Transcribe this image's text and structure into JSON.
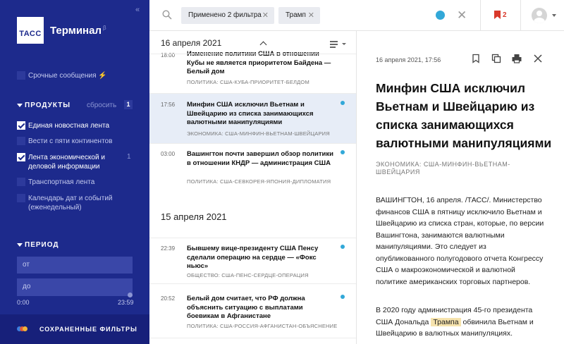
{
  "sidebar": {
    "logo": "ТАСС",
    "title": "Терминал",
    "title_sup": "β",
    "urgent": "Срочные сообщения ⚡",
    "products_header": "ПРОДУКТЫ",
    "reset": "сбросить",
    "selected_count": "1",
    "products": [
      {
        "label": "Единая новостная лента",
        "checked": true,
        "count": ""
      },
      {
        "label": "Вести с пяти континентов",
        "checked": false,
        "count": ""
      },
      {
        "label": "Лента экономической и деловой информации",
        "checked": true,
        "count": "1"
      },
      {
        "label": "Транспортная лента",
        "checked": false,
        "count": ""
      },
      {
        "label": "Календарь дат и событий (еженедельный)",
        "checked": false,
        "count": ""
      }
    ],
    "period_header": "ПЕРИОД",
    "from_placeholder": "от",
    "to_placeholder": "до",
    "range_start": "0:00",
    "range_end": "23:59",
    "saved_filters": "СОХРАНЕННЫЕ ФИЛЬТРЫ"
  },
  "topbar": {
    "filters_chip": "Применено 2 фильтра",
    "query_chip": "Трамп",
    "bookmarks_count": "2"
  },
  "feed": {
    "date_1": "16 апреля 2021",
    "date_2": "15 апреля 2021",
    "items": [
      {
        "time": "18:00",
        "title": "Изменение политики США в отношении Кубы не является приоритетом Байдена — Белый дом",
        "rubric": "ПОЛИТИКА: США-КУБА-ПРИОРИТЕТ-БЕЛДОМ",
        "selected": false,
        "dot": false
      },
      {
        "time": "17:56",
        "title": "Минфин США исключил Вьетнам и Швейцарию из списка занимающихся валютными манипуляциями",
        "rubric": "ЭКОНОМИКА: США-МИНФИН-ВЬЕТНАМ-ШВЕЙЦАРИЯ",
        "selected": true,
        "dot": true
      },
      {
        "time": "03:00",
        "title": "Вашингтон почти завершил обзор политики в отношении КНДР — администрация США",
        "rubric": "ПОЛИТИКА: США-СЕВКОРЕЯ-ЯПОНИЯ-ДИПЛОМАТИЯ",
        "selected": false,
        "dot": true
      },
      {
        "time": "22:39",
        "title": "Бывшему вице-президенту США Пенсу сделали операцию на сердце — «Фокс ньюс»",
        "rubric": "ОБЩЕСТВО: США-ПЕНС-СЕРДЦЕ-ОПЕРАЦИЯ",
        "selected": false,
        "dot": true
      },
      {
        "time": "20:52",
        "title": "Белый дом считает, что РФ должна объяснить ситуацию с выплатами боевикам в Афганистане",
        "rubric": "ПОЛИТИКА: США-РОССИЯ-АФГАНИСТАН-ОБЪЯСНЕНИЕ",
        "selected": false,
        "dot": true
      }
    ]
  },
  "article": {
    "datetime": "16 апреля 2021, 17:56",
    "title": "Минфин США исключил Вьетнам и Швейцарию из списка занимающихся валютными манипуляциями",
    "rubric": "ЭКОНОМИКА: США-МИНФИН-ВЬЕТНАМ-ШВЕЙЦАРИЯ",
    "p1": "ВАШИНГТОН, 16 апреля. /ТАСС/. Министерство финансов США в пятницу исключило Вьетнам и Швейцарию из списка стран, которые, по версии Вашингтона, занимаются валютными манипуляциями. Это следует из опубликованного полугодового отчета Конгрессу США о макроэкономической и валютной политике американских торговых партнеров.",
    "p2_before": "В 2020 году администрация 45-го президента США Дональда",
    "p2_highlight": "Трампа",
    "p2_after": "обвинила Вьетнам и Швейцарию в валютных манипуляциях."
  },
  "colors": {
    "sidebar": "#1d2a8c",
    "accent_dot": "#32a8d8",
    "bookmark": "#d9392b",
    "highlight": "#f6e3ad"
  }
}
